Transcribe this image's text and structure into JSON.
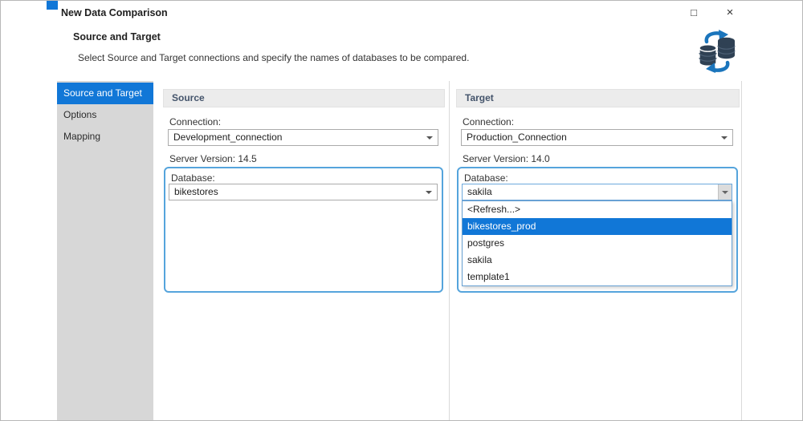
{
  "window": {
    "title": "New Data Comparison",
    "maximize_glyph": "□",
    "close_glyph": "×"
  },
  "header": {
    "title": "Source and Target",
    "subtitle": "Select Source and Target connections and specify the names of databases to be compared.",
    "icon": "database-sync-icon"
  },
  "sidebar": {
    "items": [
      {
        "label": "Source and Target",
        "selected": true
      },
      {
        "label": "Options",
        "selected": false
      },
      {
        "label": "Mapping",
        "selected": false
      }
    ]
  },
  "source": {
    "header": "Source",
    "connection_label": "Connection:",
    "connection_value": "Development_connection",
    "server_version": "Server Version: 14.5",
    "database_label": "Database:",
    "database_value": "bikestores"
  },
  "target": {
    "header": "Target",
    "connection_label": "Connection:",
    "connection_value": "Production_Connection",
    "server_version": "Server Version: 14.0",
    "database_label": "Database:",
    "database_value": "sakila",
    "dropdown_items": [
      {
        "label": "<Refresh...>",
        "selected": false
      },
      {
        "label": "bikestores_prod",
        "selected": true
      },
      {
        "label": "postgres",
        "selected": false
      },
      {
        "label": "sakila",
        "selected": false
      },
      {
        "label": "template1",
        "selected": false
      }
    ]
  },
  "colors": {
    "accent_blue": "#1177d7",
    "highlight_border": "#55a4dc",
    "sidebar_bg": "#d7d7d7",
    "panel_header_bg": "#ececec"
  }
}
